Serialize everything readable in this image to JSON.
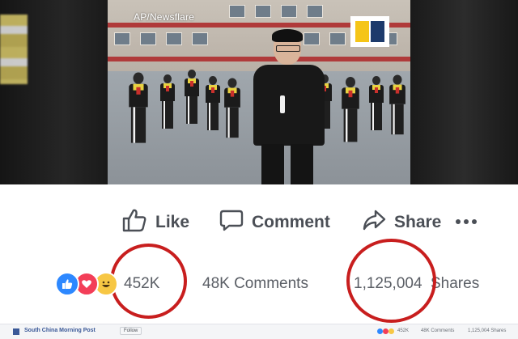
{
  "video": {
    "watermark": "AP/Newsflare",
    "logo_colors": {
      "left": "#f5c518",
      "right": "#1d3a6b"
    }
  },
  "actions": {
    "like_label": "Like",
    "comment_label": "Comment",
    "share_label": "Share"
  },
  "stats": {
    "reaction_icons": [
      "like-icon",
      "love-icon",
      "haha-icon"
    ],
    "reactions_count": "452K",
    "comments_count": "48K Comments",
    "shares_count": "1,125,004",
    "shares_suffix": "Shares"
  },
  "annotation_color": "#c81e1e",
  "footer": {
    "page_name": "South China Morning Post",
    "follow_label": "Follow",
    "mini_reactions": "452K",
    "mini_comments": "48K Comments",
    "mini_shares": "1,125,004 Shares"
  }
}
